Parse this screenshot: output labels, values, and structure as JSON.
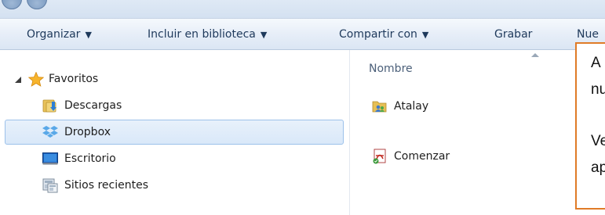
{
  "command_bar": {
    "organize_label": "Organizar",
    "include_label": "Incluir en biblioteca",
    "share_label": "Compartir con",
    "burn_label": "Grabar",
    "new_label": "Nue",
    "dropdown_glyph": "▼"
  },
  "navigation": {
    "favorites_label": "Favoritos",
    "items": [
      {
        "label": "Descargas",
        "icon": "downloads-folder-icon"
      },
      {
        "label": "Dropbox",
        "icon": "dropbox-icon",
        "selected": true
      },
      {
        "label": "Escritorio",
        "icon": "desktop-icon"
      },
      {
        "label": "Sitios recientes",
        "icon": "recent-places-icon"
      }
    ]
  },
  "content": {
    "column_header": "Nombre",
    "files": [
      {
        "label": "Atalay",
        "icon": "shared-folder-icon"
      },
      {
        "label": "Comenzar",
        "icon": "pdf-document-icon"
      }
    ]
  },
  "overlay": {
    "lines": [
      "A",
      "nu",
      "Ve",
      "ap"
    ],
    "border_color": "#e07b27"
  },
  "colors": {
    "selection_fill": "#d9e8f9",
    "selection_border": "#9cc1ea",
    "command_text": "#1e395b"
  }
}
